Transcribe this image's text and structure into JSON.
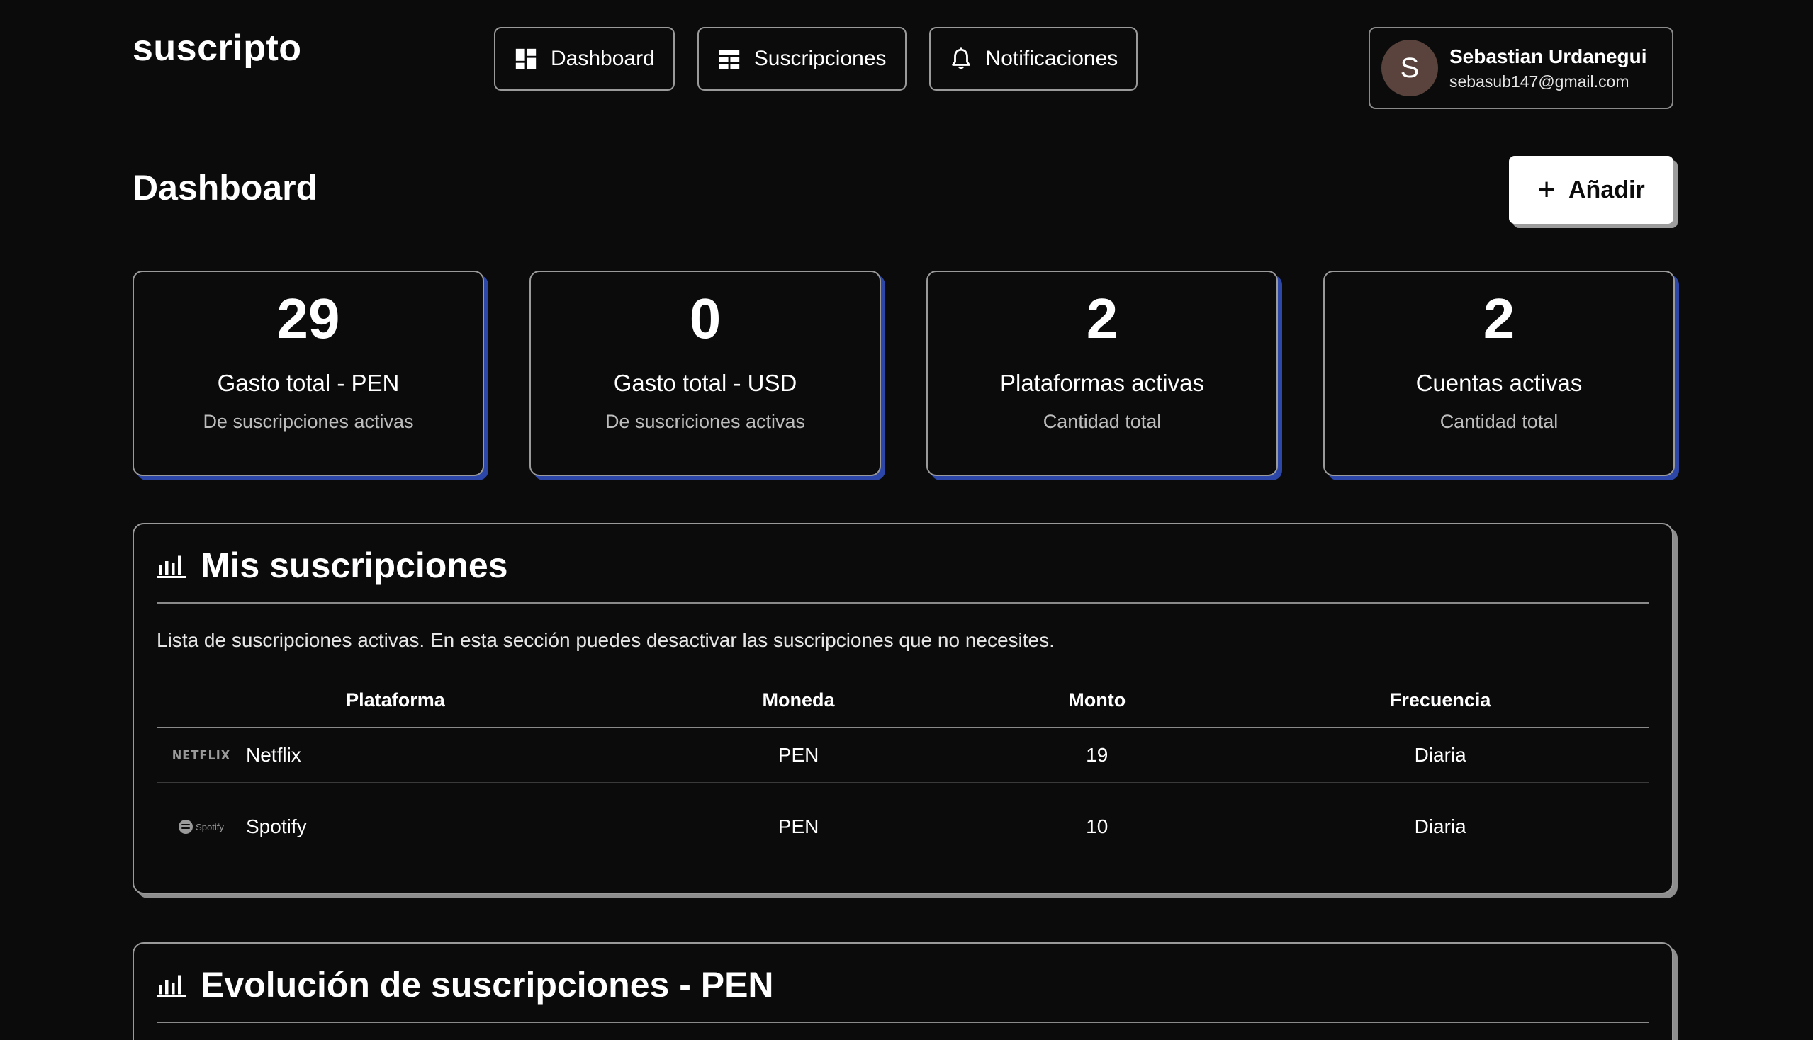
{
  "header": {
    "brand": "suscripto",
    "nav": [
      {
        "label": "Dashboard",
        "icon": "dashboard-icon"
      },
      {
        "label": "Suscripciones",
        "icon": "table-icon"
      },
      {
        "label": "Notificaciones",
        "icon": "bell-icon"
      }
    ],
    "user": {
      "initial": "S",
      "name": "Sebastian Urdanegui",
      "email": "sebasub147@gmail.com",
      "avatar_color": "#5a433c"
    }
  },
  "page": {
    "title": "Dashboard",
    "add_button": {
      "label": "Añadir",
      "icon": "plus-icon"
    }
  },
  "stats": [
    {
      "value": "29",
      "label": "Gasto total - PEN",
      "sub": "De suscripciones activas"
    },
    {
      "value": "0",
      "label": "Gasto total - USD",
      "sub": "De suscriciones activas"
    },
    {
      "value": "2",
      "label": "Plataformas activas",
      "sub": "Cantidad total"
    },
    {
      "value": "2",
      "label": "Cuentas activas",
      "sub": "Cantidad total"
    }
  ],
  "subscriptions_panel": {
    "title": "Mis suscripciones",
    "icon": "bar-chart-icon",
    "description": "Lista de suscripciones activas. En esta sección puedes desactivar las suscripciones que no necesites.",
    "columns": [
      "Plataforma",
      "Moneda",
      "Monto",
      "Frecuencia"
    ],
    "rows": [
      {
        "logo": "NETFLIX",
        "platform": "Netflix",
        "currency": "PEN",
        "amount": "19",
        "frequency": "Diaria"
      },
      {
        "logo": "Spotify",
        "platform": "Spotify",
        "currency": "PEN",
        "amount": "10",
        "frequency": "Diaria"
      }
    ]
  },
  "evolution_panel": {
    "title": "Evolución de suscripciones - PEN",
    "icon": "bar-chart-icon"
  },
  "colors": {
    "background": "#0b0b0c",
    "card_border": "#9a9a9a",
    "card_shadow_accent": "#2c47a8",
    "panel_shadow": "#8e8e8e"
  }
}
